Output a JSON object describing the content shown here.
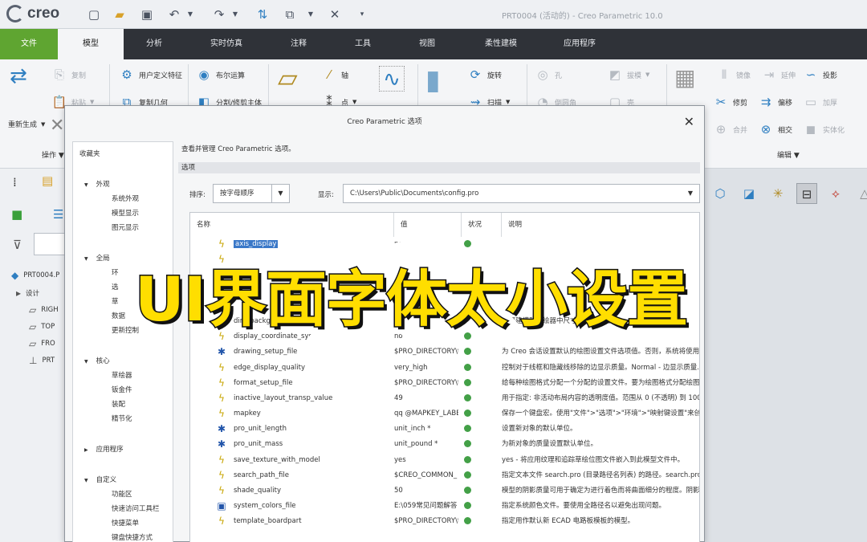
{
  "app": {
    "logo": "creo",
    "window_title": "PRT0004 (活动的) - Creo Parametric 10.0"
  },
  "tabs": [
    {
      "label": "文件"
    },
    {
      "label": "模型"
    },
    {
      "label": "分析"
    },
    {
      "label": "实时仿真"
    },
    {
      "label": "注释"
    },
    {
      "label": "工具"
    },
    {
      "label": "视图"
    },
    {
      "label": "柔性建模"
    },
    {
      "label": "应用程序"
    }
  ],
  "ribbon": {
    "copy": "复制",
    "paste": "粘贴",
    "regenerate": "重新生成",
    "user_feature": "用户定义特征",
    "copy_geometry": "复制几何",
    "boolean": "布尔运算",
    "split_body": "分割/修剪主体",
    "axis": "轴",
    "point": "点",
    "revolve": "旋转",
    "sweep": "扫描",
    "hole": "孔",
    "draft": "拔模",
    "round": "倒圆角",
    "shell": "壳",
    "mirror": "镜像",
    "extend": "延伸",
    "project": "投影",
    "trim": "修剪",
    "offset": "偏移",
    "thicken": "加厚",
    "merge": "合并",
    "intersect": "相交",
    "solidify": "实体化",
    "group_operations": "操作",
    "group_editing": "编辑"
  },
  "model_tree": {
    "root": "PRT0004.P",
    "items": [
      "设计",
      "RIGH",
      "TOP",
      "FRO",
      "PRT"
    ]
  },
  "dialog": {
    "title": "Creo Parametric 选项",
    "description": "查看并管理 Creo Parametric 选项。",
    "section": "选项",
    "sort_label": "排序:",
    "sort_value": "按字母顺序",
    "show_label": "显示:",
    "show_value": "C:\\Users\\Public\\Documents\\config.pro",
    "nav": {
      "favorites": "收藏夹",
      "appearance": "外观",
      "appearance_items": [
        "系统外观",
        "模型显示",
        "图元显示"
      ],
      "overall": "全局",
      "overall_items": [
        "环",
        "选",
        "草",
        "数据",
        "更新控制"
      ],
      "core": "核心",
      "core_items": [
        "草绘器",
        "钣金件",
        "装配",
        "精节化"
      ],
      "applications": "应用程序",
      "customize": "自定义",
      "customize_items": [
        "功能区",
        "快速访问工具栏",
        "快捷菜单",
        "键盘快捷方式"
      ]
    },
    "columns": {
      "name": "名称",
      "value": "值",
      "status": "状况",
      "description": "说明"
    },
    "rows": [
      {
        "icon": "lightning-icon",
        "name": "axis_display",
        "value": "no",
        "note": ""
      },
      {
        "icon": "lightning-icon",
        "name": "",
        "value": "",
        "note": ""
      },
      {
        "icon": "lightning-icon",
        "name": "",
        "value": "",
        "note": ""
      },
      {
        "icon": "lightning-icon",
        "name": "",
        "value": "",
        "note": ""
      },
      {
        "icon": "lightning-icon",
        "name": "",
        "value": "5",
        "note": ""
      },
      {
        "icon": "lightning-icon",
        "name": "dim_background",
        "value": "legacy",
        "note": "设置建模和草绘器中尺寸下的背景显示。"
      },
      {
        "icon": "lightning-icon",
        "name": "display_coordinate_sys",
        "value": "no",
        "note": ""
      },
      {
        "icon": "star-icon",
        "name": "drawing_setup_file",
        "value": "$PRO_DIRECTORY\\t",
        "note": "为 Creo 会话设置默认的绘图设置文件选项值。否则，系统将使用..."
      },
      {
        "icon": "lightning-icon",
        "name": "edge_display_quality",
        "value": "very_high",
        "note": "控制对于线框和隐藏线移除的边显示质量。Normal - 边显示质量..."
      },
      {
        "icon": "lightning-icon",
        "name": "format_setup_file",
        "value": "$PRO_DIRECTORY\\t",
        "note": "给每种绘图格式分配一个分配的设置文件。要为绘图格式分配绘图..."
      },
      {
        "icon": "lightning-icon",
        "name": "inactive_layout_transp_value",
        "value": "49",
        "note": "用于指定: 非活动布局内容的透明度值。范围从 0 (不透明) 到 100 (..."
      },
      {
        "icon": "lightning-icon",
        "name": "mapkey",
        "value": "qq @MAPKEY_LABE",
        "note": "保存一个键盘宏。使用\"文件\">\"选项\">\"环境\">\"映射键设置\"来创建..."
      },
      {
        "icon": "star-icon",
        "name": "pro_unit_length",
        "value": "unit_inch *",
        "note": "设置新对象的默认单位。"
      },
      {
        "icon": "star-icon",
        "name": "pro_unit_mass",
        "value": "unit_pound *",
        "note": "为新对象的质量设置默认单位。"
      },
      {
        "icon": "lightning-icon",
        "name": "save_texture_with_model",
        "value": "yes",
        "note": "yes - 将应用纹理和追踪草绘位图文件嵌入到此模型文件中。"
      },
      {
        "icon": "lightning-icon",
        "name": "search_path_file",
        "value": "$CREO_COMMON_",
        "note": "指定文本文件 search.pro (目录路径名列表) 的路径。search.pro 中..."
      },
      {
        "icon": "lightning-icon",
        "name": "shade_quality",
        "value": "50",
        "note": "模型的阴影质量可用于确定为进行着色而将曲面细分的程度。阴影..."
      },
      {
        "icon": "box-icon",
        "name": "system_colors_file",
        "value": "E:\\059常见问题解答",
        "note": "指定系统颜色文件。要使用全路径名以避免出现问题。"
      },
      {
        "icon": "lightning-icon",
        "name": "template_boardpart",
        "value": "$PRO_DIRECTORY\\t",
        "note": "指定用作默认新 ECAD 电路板模板的模型。"
      }
    ]
  },
  "overlay": {
    "caption": "UI界面字体太小设置"
  }
}
